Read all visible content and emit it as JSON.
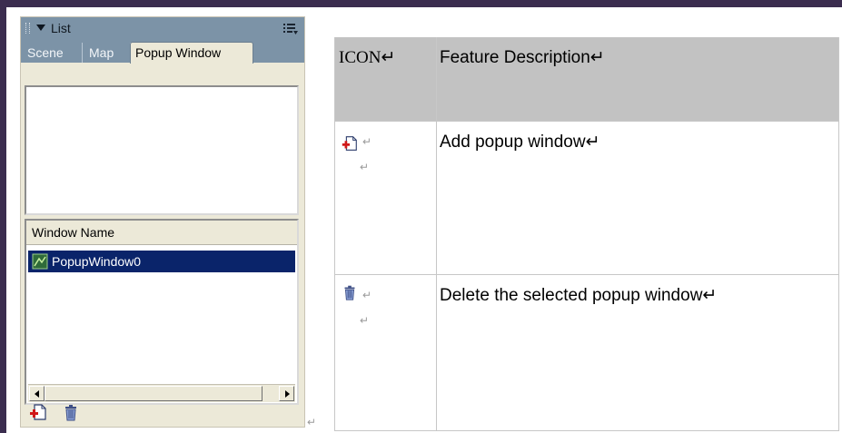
{
  "panel": {
    "title": "List",
    "tabs": [
      "Scene",
      "Map",
      "Popup Window"
    ],
    "active_tab": "Popup Window",
    "list_header": "Window Name",
    "items": [
      {
        "label": "PopupWindow0",
        "selected": true
      }
    ],
    "colors": {
      "header": "#7c93a7",
      "selection": "#0a246a",
      "panel_bg": "#ece9d8"
    }
  },
  "table": {
    "headers": [
      "ICON↵",
      "Feature Description↵"
    ],
    "rows": [
      {
        "icon": "add-window-icon",
        "description": "Add popup window↵"
      },
      {
        "icon": "trash-icon",
        "description": "Delete the selected popup window↵"
      }
    ],
    "colors": {
      "header_bg": "#c2c2c2"
    }
  },
  "marks": {
    "para": "↵"
  }
}
